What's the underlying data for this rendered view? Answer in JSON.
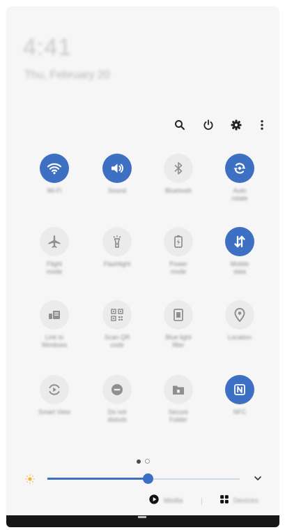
{
  "status": {
    "time": "4:41",
    "date": "Thu, February 20"
  },
  "header_icons": [
    "search-icon",
    "power-icon",
    "gear-icon",
    "more-vert-icon"
  ],
  "colors": {
    "accent": "#3d6fc3",
    "tile_off": "#ebebeb",
    "panel_bg": "#f6f6f6"
  },
  "tiles": [
    {
      "label": "Wi-Fi",
      "icon": "wifi-icon",
      "on": true
    },
    {
      "label": "Sound",
      "icon": "volume-icon",
      "on": true
    },
    {
      "label": "Bluetooth",
      "icon": "bluetooth-icon",
      "on": false
    },
    {
      "label": "Auto\nrotate",
      "icon": "auto-rotate-icon",
      "on": true
    },
    {
      "label": "Flight\nmode",
      "icon": "airplane-icon",
      "on": false
    },
    {
      "label": "Flashlight",
      "icon": "flashlight-icon",
      "on": false
    },
    {
      "label": "Power\nmode",
      "icon": "power-mode-icon",
      "on": false
    },
    {
      "label": "Mobile\ndata",
      "icon": "mobile-data-icon",
      "on": true
    },
    {
      "label": "Link to\nWindows",
      "icon": "link-to-windows-icon",
      "on": false
    },
    {
      "label": "Scan QR\ncode",
      "icon": "qr-code-icon",
      "on": false
    },
    {
      "label": "Blue light\nfilter",
      "icon": "blue-light-icon",
      "on": false
    },
    {
      "label": "Location",
      "icon": "location-icon",
      "on": false
    },
    {
      "label": "Smart View",
      "icon": "smart-view-icon",
      "on": false
    },
    {
      "label": "Do not\ndisturb",
      "icon": "do-not-disturb-icon",
      "on": false
    },
    {
      "label": "Secure\nFolder",
      "icon": "secure-folder-icon",
      "on": false
    },
    {
      "label": "NFC",
      "icon": "nfc-icon",
      "on": true
    }
  ],
  "pager": {
    "pages": 2,
    "current": 1
  },
  "brightness": {
    "level": 0.52
  },
  "bottom": {
    "media_label": "Media",
    "devices_label": "Devices"
  }
}
